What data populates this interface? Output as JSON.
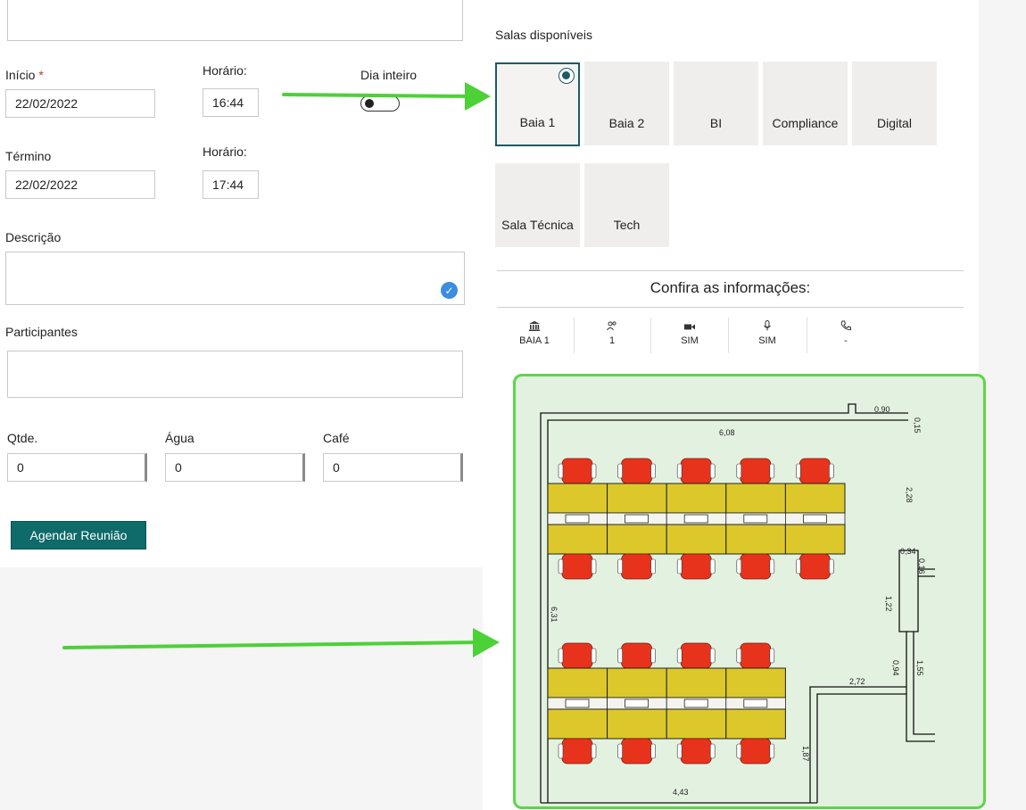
{
  "form": {
    "inicio_label": "Início",
    "required_mark": "*",
    "inicio_value": "22/02/2022",
    "horario_label_1": "Horário:",
    "horario_value_1": "16:44",
    "dia_inteiro_label": "Dia inteiro",
    "termino_label": "Término",
    "termino_value": "22/02/2022",
    "horario_label_2": "Horário:",
    "horario_value_2": "17:44",
    "descricao_label": "Descrição",
    "participantes_label": "Participantes",
    "qtde_label": "Qtde.",
    "qtde_value": "0",
    "agua_label": "Água",
    "agua_value": "0",
    "cafe_label": "Café",
    "cafe_value": "0",
    "submit_label": "Agendar Reunião"
  },
  "rooms": {
    "title": "Salas disponíveis",
    "items": [
      "Baia 1",
      "Baia 2",
      "BI",
      "Compliance",
      "Digital",
      "Sala Técnica",
      "Tech"
    ],
    "selected": "Baia 1"
  },
  "info": {
    "title": "Confira as informações:",
    "cells": [
      {
        "icon": "building-icon",
        "value": "BAIA 1"
      },
      {
        "icon": "people-icon",
        "value": "1"
      },
      {
        "icon": "camera-icon",
        "value": "SIM"
      },
      {
        "icon": "microphone-icon",
        "value": "SIM"
      },
      {
        "icon": "phone-icon",
        "value": "-"
      }
    ]
  },
  "floorplan": {
    "dimensions": [
      "6,08",
      "0,90",
      "0,15",
      "2,28",
      "0,34",
      "0,16",
      "1,22",
      "6,31",
      "0,94",
      "2,72",
      "1,55",
      "1,87",
      "4,43"
    ]
  },
  "colors": {
    "accent": "#0f6a6a",
    "arrow": "#4cd137",
    "chair": "#e8331c",
    "desk": "#dcc82a",
    "plan_bg": "#e3f2e0"
  }
}
